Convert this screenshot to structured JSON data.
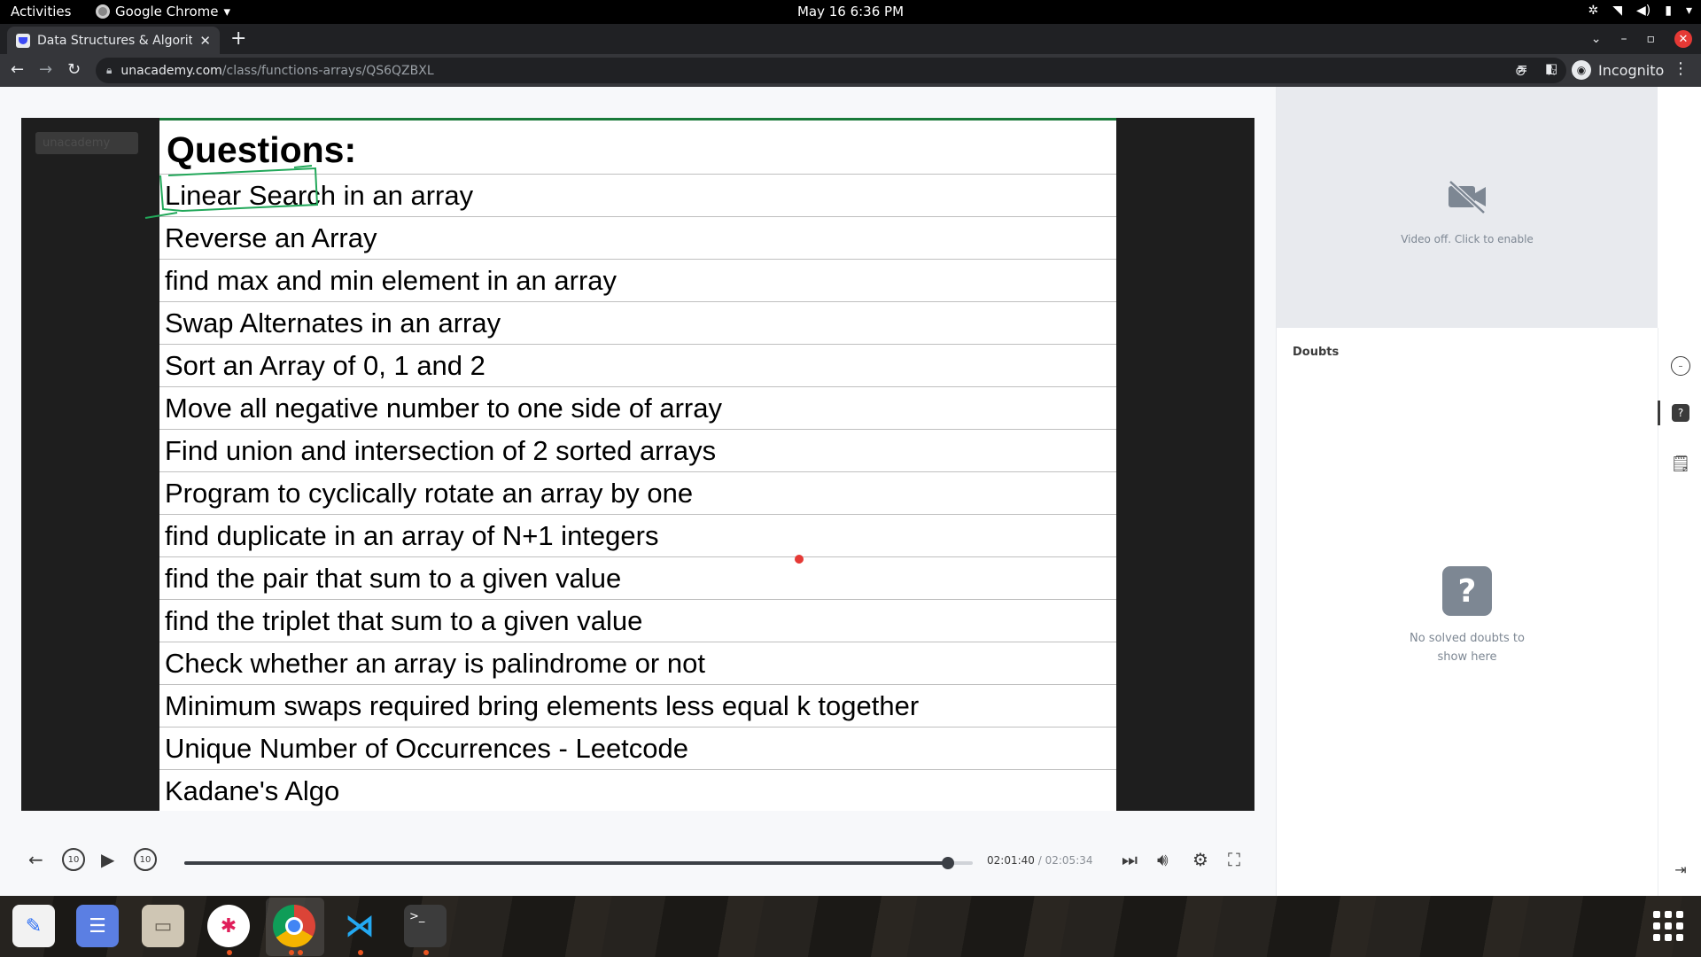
{
  "system": {
    "activities": "Activities",
    "app_name": "Google Chrome",
    "clock": "May 16   6:36 PM"
  },
  "browser": {
    "tab_title": "Data Structures & Algorit",
    "url_host": "unacademy.com",
    "url_path": "/class/functions-arrays/QS6QZBXL",
    "profile_label": "Incognito"
  },
  "video": {
    "watermark": "unacademy",
    "slide_title": "Questions:",
    "questions": [
      "Linear Search in an array",
      "Reverse an Array",
      "find max and min element in an array",
      "Swap Alternates in an array",
      "Sort an Array of 0, 1 and 2",
      "Move all negative number to one side of array",
      "Find union and intersection of 2 sorted arrays",
      "Program to cyclically rotate an array by one",
      "find duplicate in an array of N+1 integers",
      "find the pair that sum to a given value",
      "find the triplet that sum to a given value",
      "Check whether an array is palindrome or not",
      "Minimum swaps required bring elements less equal k together",
      "Unique Number of Occurrences - Leetcode",
      "Kadane's Algo"
    ],
    "rewind_label": "10",
    "forward_label": "10",
    "current_time": "02:01:40",
    "separator": "/",
    "total_time": "02:05:34",
    "progress_fraction": 0.969
  },
  "panel": {
    "video_off_text": "Video off. Click to enable",
    "doubts_title": "Doubts",
    "empty_icon": "?",
    "empty_text": "No solved doubts to show here"
  },
  "dock": {
    "apps": [
      "text-editor-icon",
      "tasks-icon",
      "files-icon",
      "slack-icon",
      "chrome-icon",
      "vscode-icon",
      "terminal-icon"
    ]
  }
}
